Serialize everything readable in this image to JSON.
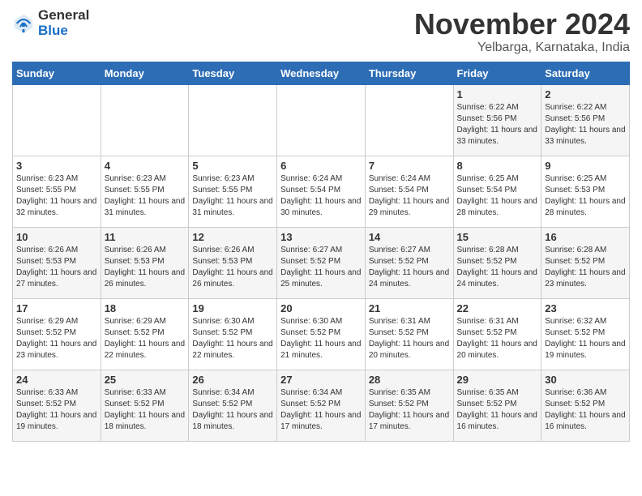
{
  "logo": {
    "text_general": "General",
    "text_blue": "Blue"
  },
  "title": "November 2024",
  "subtitle": "Yelbarga, Karnataka, India",
  "days_of_week": [
    "Sunday",
    "Monday",
    "Tuesday",
    "Wednesday",
    "Thursday",
    "Friday",
    "Saturday"
  ],
  "weeks": [
    [
      {
        "day": "",
        "sunrise": "",
        "sunset": "",
        "daylight": ""
      },
      {
        "day": "",
        "sunrise": "",
        "sunset": "",
        "daylight": ""
      },
      {
        "day": "",
        "sunrise": "",
        "sunset": "",
        "daylight": ""
      },
      {
        "day": "",
        "sunrise": "",
        "sunset": "",
        "daylight": ""
      },
      {
        "day": "",
        "sunrise": "",
        "sunset": "",
        "daylight": ""
      },
      {
        "day": "1",
        "sunrise": "6:22 AM",
        "sunset": "5:56 PM",
        "daylight": "11 hours and 33 minutes."
      },
      {
        "day": "2",
        "sunrise": "6:22 AM",
        "sunset": "5:56 PM",
        "daylight": "11 hours and 33 minutes."
      }
    ],
    [
      {
        "day": "3",
        "sunrise": "6:23 AM",
        "sunset": "5:55 PM",
        "daylight": "11 hours and 32 minutes."
      },
      {
        "day": "4",
        "sunrise": "6:23 AM",
        "sunset": "5:55 PM",
        "daylight": "11 hours and 31 minutes."
      },
      {
        "day": "5",
        "sunrise": "6:23 AM",
        "sunset": "5:55 PM",
        "daylight": "11 hours and 31 minutes."
      },
      {
        "day": "6",
        "sunrise": "6:24 AM",
        "sunset": "5:54 PM",
        "daylight": "11 hours and 30 minutes."
      },
      {
        "day": "7",
        "sunrise": "6:24 AM",
        "sunset": "5:54 PM",
        "daylight": "11 hours and 29 minutes."
      },
      {
        "day": "8",
        "sunrise": "6:25 AM",
        "sunset": "5:54 PM",
        "daylight": "11 hours and 28 minutes."
      },
      {
        "day": "9",
        "sunrise": "6:25 AM",
        "sunset": "5:53 PM",
        "daylight": "11 hours and 28 minutes."
      }
    ],
    [
      {
        "day": "10",
        "sunrise": "6:26 AM",
        "sunset": "5:53 PM",
        "daylight": "11 hours and 27 minutes."
      },
      {
        "day": "11",
        "sunrise": "6:26 AM",
        "sunset": "5:53 PM",
        "daylight": "11 hours and 26 minutes."
      },
      {
        "day": "12",
        "sunrise": "6:26 AM",
        "sunset": "5:53 PM",
        "daylight": "11 hours and 26 minutes."
      },
      {
        "day": "13",
        "sunrise": "6:27 AM",
        "sunset": "5:52 PM",
        "daylight": "11 hours and 25 minutes."
      },
      {
        "day": "14",
        "sunrise": "6:27 AM",
        "sunset": "5:52 PM",
        "daylight": "11 hours and 24 minutes."
      },
      {
        "day": "15",
        "sunrise": "6:28 AM",
        "sunset": "5:52 PM",
        "daylight": "11 hours and 24 minutes."
      },
      {
        "day": "16",
        "sunrise": "6:28 AM",
        "sunset": "5:52 PM",
        "daylight": "11 hours and 23 minutes."
      }
    ],
    [
      {
        "day": "17",
        "sunrise": "6:29 AM",
        "sunset": "5:52 PM",
        "daylight": "11 hours and 23 minutes."
      },
      {
        "day": "18",
        "sunrise": "6:29 AM",
        "sunset": "5:52 PM",
        "daylight": "11 hours and 22 minutes."
      },
      {
        "day": "19",
        "sunrise": "6:30 AM",
        "sunset": "5:52 PM",
        "daylight": "11 hours and 22 minutes."
      },
      {
        "day": "20",
        "sunrise": "6:30 AM",
        "sunset": "5:52 PM",
        "daylight": "11 hours and 21 minutes."
      },
      {
        "day": "21",
        "sunrise": "6:31 AM",
        "sunset": "5:52 PM",
        "daylight": "11 hours and 20 minutes."
      },
      {
        "day": "22",
        "sunrise": "6:31 AM",
        "sunset": "5:52 PM",
        "daylight": "11 hours and 20 minutes."
      },
      {
        "day": "23",
        "sunrise": "6:32 AM",
        "sunset": "5:52 PM",
        "daylight": "11 hours and 19 minutes."
      }
    ],
    [
      {
        "day": "24",
        "sunrise": "6:33 AM",
        "sunset": "5:52 PM",
        "daylight": "11 hours and 19 minutes."
      },
      {
        "day": "25",
        "sunrise": "6:33 AM",
        "sunset": "5:52 PM",
        "daylight": "11 hours and 18 minutes."
      },
      {
        "day": "26",
        "sunrise": "6:34 AM",
        "sunset": "5:52 PM",
        "daylight": "11 hours and 18 minutes."
      },
      {
        "day": "27",
        "sunrise": "6:34 AM",
        "sunset": "5:52 PM",
        "daylight": "11 hours and 17 minutes."
      },
      {
        "day": "28",
        "sunrise": "6:35 AM",
        "sunset": "5:52 PM",
        "daylight": "11 hours and 17 minutes."
      },
      {
        "day": "29",
        "sunrise": "6:35 AM",
        "sunset": "5:52 PM",
        "daylight": "11 hours and 16 minutes."
      },
      {
        "day": "30",
        "sunrise": "6:36 AM",
        "sunset": "5:52 PM",
        "daylight": "11 hours and 16 minutes."
      }
    ]
  ]
}
